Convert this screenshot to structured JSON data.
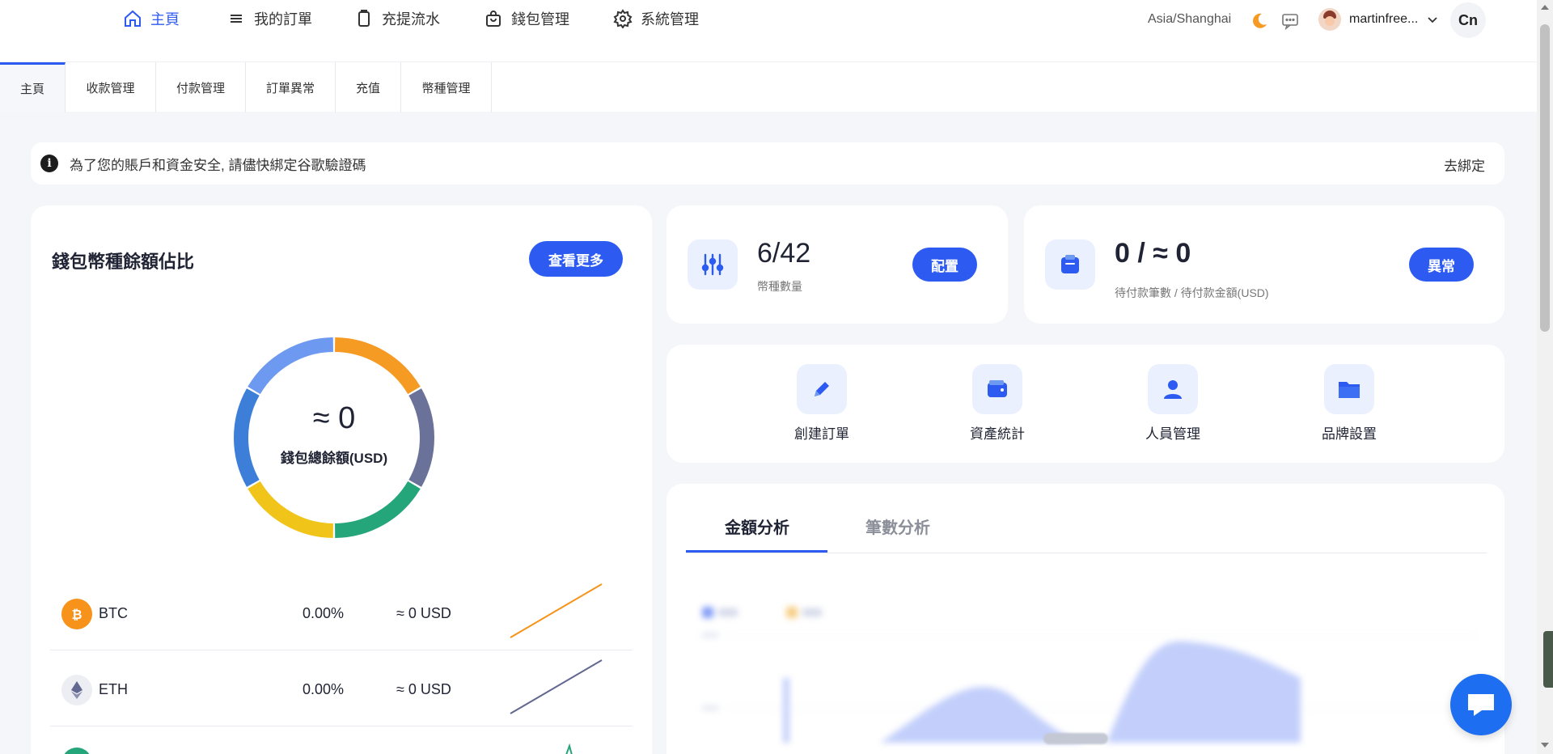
{
  "topnav": {
    "items": [
      {
        "label": "主頁",
        "icon": "home-icon",
        "active": true
      },
      {
        "label": "我的訂單",
        "icon": "menu-icon"
      },
      {
        "label": "充提流水",
        "icon": "clipboard-icon"
      },
      {
        "label": "錢包管理",
        "icon": "bag-icon"
      },
      {
        "label": "系統管理",
        "icon": "gear-icon"
      }
    ],
    "timezone": "Asia/Shanghai",
    "username": "martinfree...",
    "lang": "Cn"
  },
  "tabs": [
    {
      "label": "主頁",
      "active": true
    },
    {
      "label": "收款管理"
    },
    {
      "label": "付款管理"
    },
    {
      "label": "訂單異常"
    },
    {
      "label": "充值"
    },
    {
      "label": "幣種管理"
    }
  ],
  "notice": {
    "text": "為了您的賬戶和資金安全, 請儘快綁定谷歌驗證碼",
    "link": "去綁定"
  },
  "wallet": {
    "title": "錢包幣種餘額佔比",
    "more_button": "查看更多",
    "total_value": "≈ 0",
    "total_label": "錢包總餘額(USD)",
    "coins": [
      {
        "name": "BTC",
        "pct": "0.00%",
        "value": "≈ 0 USD",
        "color": "#f7931a"
      },
      {
        "name": "ETH",
        "pct": "0.00%",
        "value": "≈ 0 USD",
        "color": "#626890"
      }
    ]
  },
  "stats": {
    "currency": {
      "value": "6/42",
      "label": "幣種數量",
      "button": "配置"
    },
    "pending": {
      "value": "0 / ≈ 0",
      "label": "待付款筆數 / 待付款金額(USD)",
      "button": "異常"
    }
  },
  "quick_actions": [
    {
      "label": "創建訂單",
      "icon": "pencil-icon"
    },
    {
      "label": "資產統計",
      "icon": "wallet-icon"
    },
    {
      "label": "人員管理",
      "icon": "user-icon"
    },
    {
      "label": "品牌設置",
      "icon": "folder-icon"
    }
  ],
  "analysis": {
    "tabs": [
      {
        "label": "金額分析",
        "active": true
      },
      {
        "label": "筆數分析"
      }
    ]
  },
  "colors": {
    "accent": "#2d5bf2",
    "donut": [
      "#f59a23",
      "#6b7299",
      "#24a57a",
      "#f0c419",
      "#3d7fd8",
      "#6d9af0"
    ]
  }
}
